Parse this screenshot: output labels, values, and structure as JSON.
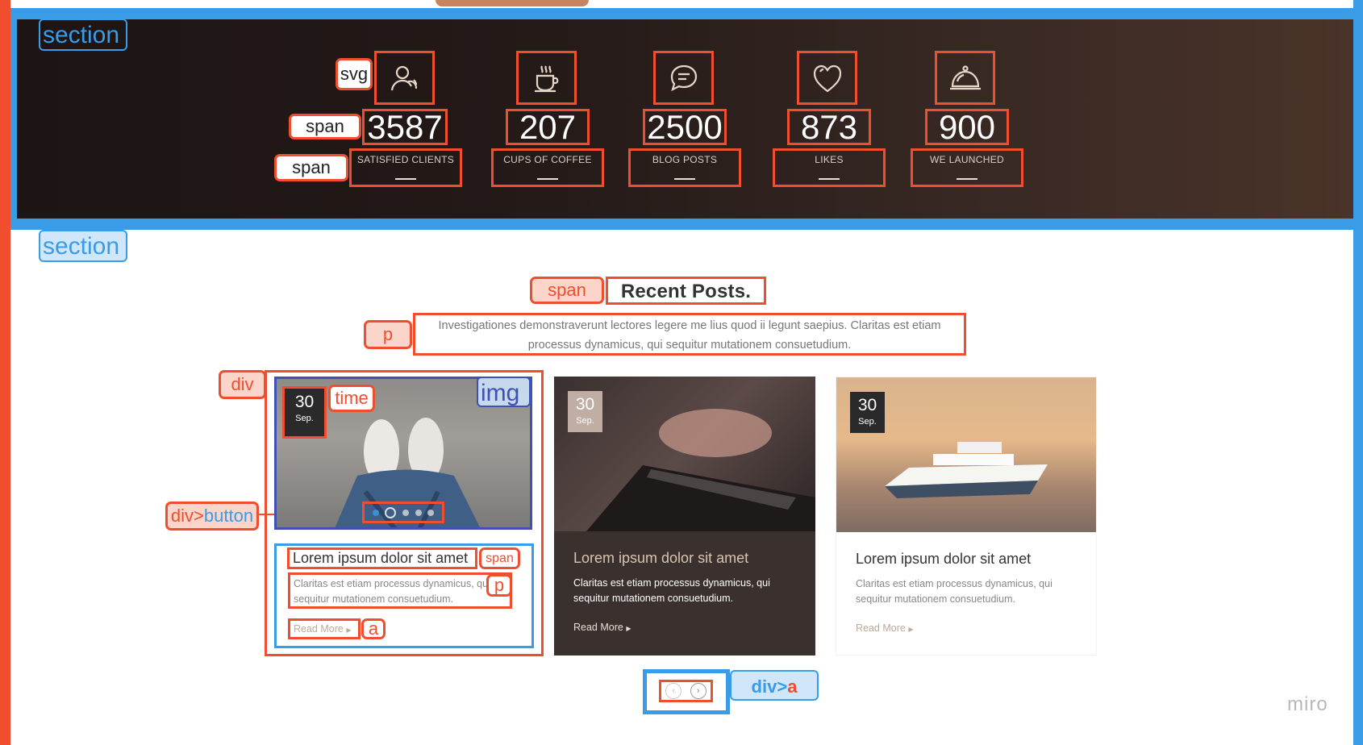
{
  "labels": {
    "section1": "section",
    "section2": "section",
    "svg": "svg",
    "span_num": "span",
    "span_lbl": "span",
    "span_title": "span",
    "p_desc": "p",
    "div": "div",
    "time": "time",
    "img": "img",
    "div_button_a": "div>",
    "div_button_b": "button",
    "card_span": "span",
    "card_p": "p",
    "card_a": "a",
    "nav_div": "div>",
    "nav_a": "a"
  },
  "stats": [
    {
      "number": "3587",
      "label": "SATISFIED CLIENTS",
      "icon": "user-icon"
    },
    {
      "number": "207",
      "label": "CUPS OF COFFEE",
      "icon": "coffee-cup-icon"
    },
    {
      "number": "2500",
      "label": "BLOG POSTS",
      "icon": "chat-bubble-icon"
    },
    {
      "number": "873",
      "label": "LIKES",
      "icon": "heart-icon"
    },
    {
      "number": "900",
      "label": "WE LAUNCHED",
      "icon": "cloche-icon"
    }
  ],
  "recent_posts": {
    "title": "Recent Posts.",
    "description_line1": "Investigationes demonstraverunt lectores legere me lius quod ii legunt saepius. Claritas est etiam",
    "description_line2": "processus dynamicus, qui sequitur mutationem consuetudium."
  },
  "posts": [
    {
      "day": "30",
      "month": "Sep.",
      "title": "Lorem ipsum dolor sit amet",
      "text_line1": "Claritas est etiam processus dynamicus, qui",
      "text_line2": "sequitur mutationem consuetudium.",
      "link": "Read More",
      "theme": "light"
    },
    {
      "day": "30",
      "month": "Sep.",
      "title": "Lorem ipsum dolor sit amet",
      "text_line1": "Claritas est etiam processus dynamicus, qui",
      "text_line2": "sequitur mutationem consuetudium.",
      "link": "Read More",
      "theme": "dark"
    },
    {
      "day": "30",
      "month": "Sep.",
      "title": "Lorem ipsum dolor sit amet",
      "text_line1": "Claritas est etiam processus dynamicus, qui",
      "text_line2": "sequitur mutationem consuetudium.",
      "link": "Read More",
      "theme": "light"
    }
  ],
  "watermark": "miro",
  "colors": {
    "annotation_red": "#f04e2e",
    "annotation_blue": "#3a9be6",
    "annotation_purple": "#3f51b5",
    "stats_bg_start": "#1c1514",
    "stats_bg_end": "#4a3329",
    "accent_tan": "#bfa996"
  }
}
